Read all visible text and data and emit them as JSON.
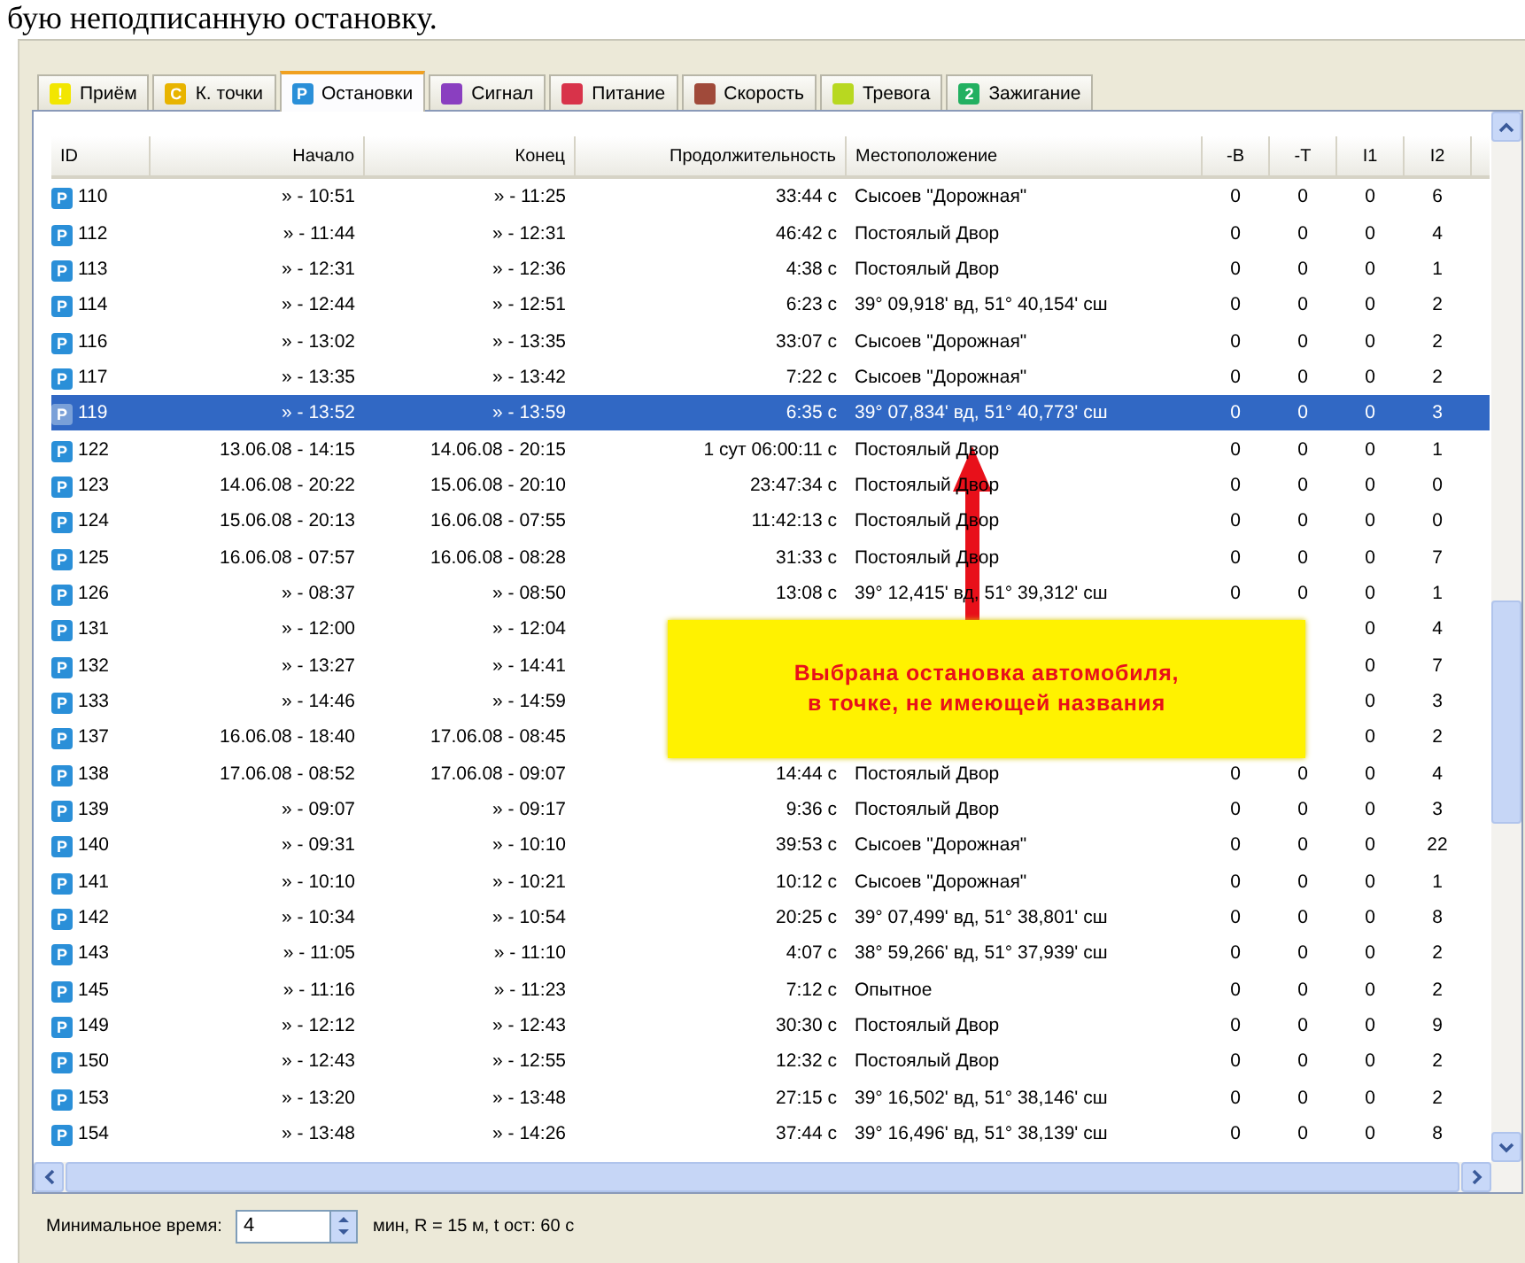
{
  "caption": "бую неподписанную остановку.",
  "tabs": [
    {
      "label": "Приём",
      "glyph": "!",
      "color": "#f2e600",
      "selected": false
    },
    {
      "label": "К. точки",
      "glyph": "C",
      "color": "#e8b400",
      "selected": false
    },
    {
      "label": "Остановки",
      "glyph": "P",
      "color": "#2a8fd8",
      "selected": true
    },
    {
      "label": "Сигнал",
      "color": "#8a3fc0",
      "selected": false
    },
    {
      "label": "Питание",
      "color": "#d8334a",
      "selected": false
    },
    {
      "label": "Скорость",
      "color": "#a04a3a",
      "selected": false
    },
    {
      "label": "Тревога",
      "color": "#b8d820",
      "selected": false
    },
    {
      "label": "Зажигание",
      "glyph": "2",
      "color": "#22b060",
      "selected": false
    }
  ],
  "table": {
    "columns": [
      "ID",
      "Начало",
      "Конец",
      "Продолжительность",
      "Местоположение",
      "-B",
      "-T",
      "I1",
      "I2"
    ],
    "rows": [
      {
        "icon": "P",
        "id": "110",
        "start": "» - 10:51",
        "end": "» - 11:25",
        "duration": "33:44 с",
        "location": "Сысоев \"Дорожная\"",
        "b": "0",
        "t": "0",
        "i1": "0",
        "i2": "6",
        "selected": false
      },
      {
        "icon": "P",
        "id": "112",
        "start": "» - 11:44",
        "end": "» - 12:31",
        "duration": "46:42 с",
        "location": "Постоялый Двор",
        "b": "0",
        "t": "0",
        "i1": "0",
        "i2": "4",
        "selected": false
      },
      {
        "icon": "P",
        "id": "113",
        "start": "» - 12:31",
        "end": "» - 12:36",
        "duration": "4:38 с",
        "location": "Постоялый Двор",
        "b": "0",
        "t": "0",
        "i1": "0",
        "i2": "1",
        "selected": false
      },
      {
        "icon": "P",
        "id": "114",
        "start": "» - 12:44",
        "end": "» - 12:51",
        "duration": "6:23 с",
        "location": "39° 09,918' вд, 51° 40,154' сш",
        "b": "0",
        "t": "0",
        "i1": "0",
        "i2": "2",
        "selected": false
      },
      {
        "icon": "P",
        "id": "116",
        "start": "» - 13:02",
        "end": "» - 13:35",
        "duration": "33:07 с",
        "location": "Сысоев \"Дорожная\"",
        "b": "0",
        "t": "0",
        "i1": "0",
        "i2": "2",
        "selected": false
      },
      {
        "icon": "P",
        "id": "117",
        "start": "» - 13:35",
        "end": "» - 13:42",
        "duration": "7:22 с",
        "location": "Сысоев \"Дорожная\"",
        "b": "0",
        "t": "0",
        "i1": "0",
        "i2": "2",
        "selected": false
      },
      {
        "icon": "P",
        "id": "119",
        "start": "» - 13:52",
        "end": "» - 13:59",
        "duration": "6:35 с",
        "location": "39° 07,834' вд, 51° 40,773' сш",
        "b": "0",
        "t": "0",
        "i1": "0",
        "i2": "3",
        "selected": true
      },
      {
        "icon": "P",
        "id": "122",
        "start": "13.06.08 - 14:15",
        "end": "14.06.08 - 20:15",
        "duration": "1 сут 06:00:11 с",
        "location": "Постоялый Двор",
        "b": "0",
        "t": "0",
        "i1": "0",
        "i2": "1",
        "selected": false
      },
      {
        "icon": "P",
        "id": "123",
        "start": "14.06.08 - 20:22",
        "end": "15.06.08 - 20:10",
        "duration": "23:47:34 с",
        "location": "Постоялый Двор",
        "b": "0",
        "t": "0",
        "i1": "0",
        "i2": "0",
        "selected": false
      },
      {
        "icon": "P",
        "id": "124",
        "start": "15.06.08 - 20:13",
        "end": "16.06.08 - 07:55",
        "duration": "11:42:13 с",
        "location": "Постоялый Двор",
        "b": "0",
        "t": "0",
        "i1": "0",
        "i2": "0",
        "selected": false
      },
      {
        "icon": "P",
        "id": "125",
        "start": "16.06.08 - 07:57",
        "end": "16.06.08 - 08:28",
        "duration": "31:33 с",
        "location": "Постоялый Двор",
        "b": "0",
        "t": "0",
        "i1": "0",
        "i2": "7",
        "selected": false
      },
      {
        "icon": "P",
        "id": "126",
        "start": "» - 08:37",
        "end": "» - 08:50",
        "duration": "13:08 с",
        "location": "39° 12,415' вд, 51° 39,312' сш",
        "b": "0",
        "t": "0",
        "i1": "0",
        "i2": "1",
        "selected": false
      },
      {
        "icon": "P",
        "id": "131",
        "start": "» - 12:00",
        "end": "» - 12:04",
        "i1": "0",
        "i2": "4",
        "selected": false
      },
      {
        "icon": "P",
        "id": "132",
        "start": "» - 13:27",
        "end": "» - 14:41",
        "i1": "0",
        "i2": "7",
        "selected": false
      },
      {
        "icon": "P",
        "id": "133",
        "start": "» - 14:46",
        "end": "» - 14:59",
        "i1": "0",
        "i2": "3",
        "selected": false
      },
      {
        "icon": "P",
        "id": "137",
        "start": "16.06.08 - 18:40",
        "end": "17.06.08 - 08:45",
        "i1": "0",
        "i2": "2",
        "selected": false
      },
      {
        "icon": "P",
        "id": "138",
        "start": "17.06.08 - 08:52",
        "end": "17.06.08 - 09:07",
        "duration": "14:44 с",
        "location": "Постоялый Двор",
        "b": "0",
        "t": "0",
        "i1": "0",
        "i2": "4",
        "selected": false
      },
      {
        "icon": "P",
        "id": "139",
        "start": "» - 09:07",
        "end": "» - 09:17",
        "duration": "9:36 с",
        "location": "Постоялый Двор",
        "b": "0",
        "t": "0",
        "i1": "0",
        "i2": "3",
        "selected": false
      },
      {
        "icon": "P",
        "id": "140",
        "start": "» - 09:31",
        "end": "» - 10:10",
        "duration": "39:53 с",
        "location": "Сысоев \"Дорожная\"",
        "b": "0",
        "t": "0",
        "i1": "0",
        "i2": "22",
        "selected": false
      },
      {
        "icon": "P",
        "id": "141",
        "start": "» - 10:10",
        "end": "» - 10:21",
        "duration": "10:12 с",
        "location": "Сысоев \"Дорожная\"",
        "b": "0",
        "t": "0",
        "i1": "0",
        "i2": "1",
        "selected": false
      },
      {
        "icon": "P",
        "id": "142",
        "start": "» - 10:34",
        "end": "» - 10:54",
        "duration": "20:25 с",
        "location": "39° 07,499' вд, 51° 38,801' сш",
        "b": "0",
        "t": "0",
        "i1": "0",
        "i2": "8",
        "selected": false
      },
      {
        "icon": "P",
        "id": "143",
        "start": "» - 11:05",
        "end": "» - 11:10",
        "duration": "4:07 с",
        "location": "38° 59,266' вд, 51° 37,939' сш",
        "b": "0",
        "t": "0",
        "i1": "0",
        "i2": "2",
        "selected": false
      },
      {
        "icon": "P",
        "id": "145",
        "start": "» - 11:16",
        "end": "» - 11:23",
        "duration": "7:12 с",
        "location": "Опытное",
        "b": "0",
        "t": "0",
        "i1": "0",
        "i2": "2",
        "selected": false
      },
      {
        "icon": "P",
        "id": "149",
        "start": "» - 12:12",
        "end": "» - 12:43",
        "duration": "30:30 с",
        "location": "Постоялый Двор",
        "b": "0",
        "t": "0",
        "i1": "0",
        "i2": "9",
        "selected": false
      },
      {
        "icon": "P",
        "id": "150",
        "start": "» - 12:43",
        "end": "» - 12:55",
        "duration": "12:32 с",
        "location": "Постоялый Двор",
        "b": "0",
        "t": "0",
        "i1": "0",
        "i2": "2",
        "selected": false
      },
      {
        "icon": "P",
        "id": "153",
        "start": "» - 13:20",
        "end": "» - 13:48",
        "duration": "27:15 с",
        "location": "39° 16,502' вд, 51° 38,146' сш",
        "b": "0",
        "t": "0",
        "i1": "0",
        "i2": "2",
        "selected": false
      },
      {
        "icon": "P",
        "id": "154",
        "start": "» - 13:48",
        "end": "» - 14:26",
        "duration": "37:44 с",
        "location": "39° 16,496' вд, 51° 38,139' сш",
        "b": "0",
        "t": "0",
        "i1": "0",
        "i2": "8",
        "selected": false
      }
    ]
  },
  "callout": "Выбрана остановка автомобиля, в точке, не имеющей названия",
  "footer": {
    "label": "Минимальное время:",
    "value": "4",
    "note": "мин, R = 15 м, t ост: 60 с"
  }
}
